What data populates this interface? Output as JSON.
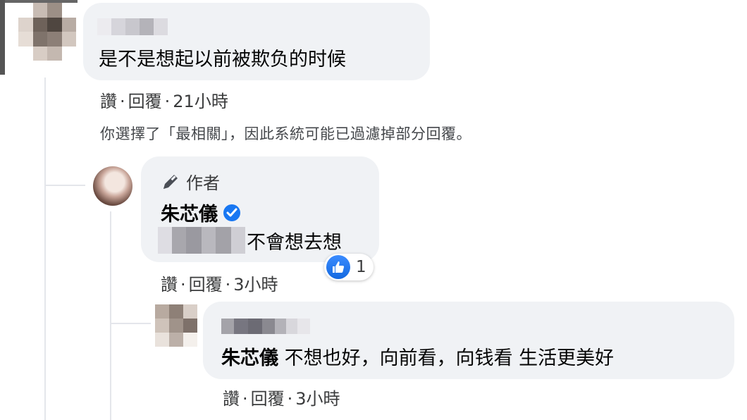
{
  "comments": {
    "top": {
      "text": "是不是想起以前被欺负的时候",
      "actions": {
        "like": "讚",
        "reply": "回覆",
        "time": "21小時"
      }
    },
    "filter_notice": "你選擇了「最相關」，因此系統可能已過濾掉部分回覆。",
    "author_reply": {
      "author_badge": "作者",
      "name": "朱芯儀",
      "text": "不會想去想",
      "reaction_count": "1",
      "actions": {
        "like": "讚",
        "reply": "回覆",
        "time": "3小時"
      }
    },
    "nested_reply": {
      "mention": "朱芯儀",
      "text": "不想也好，向前看，向钱看 生活更美好",
      "actions": {
        "like": "讚",
        "reply": "回覆",
        "time": "3小時"
      }
    }
  },
  "colors": {
    "bubble": "#f0f2f5",
    "verified": "#1877f2",
    "like": "#1877f2",
    "thread_line": "#e4e6eb"
  },
  "icons": {
    "author_badge": "pencil-icon",
    "verified": "verified-check-icon",
    "reaction": "thumbs-up-icon"
  }
}
